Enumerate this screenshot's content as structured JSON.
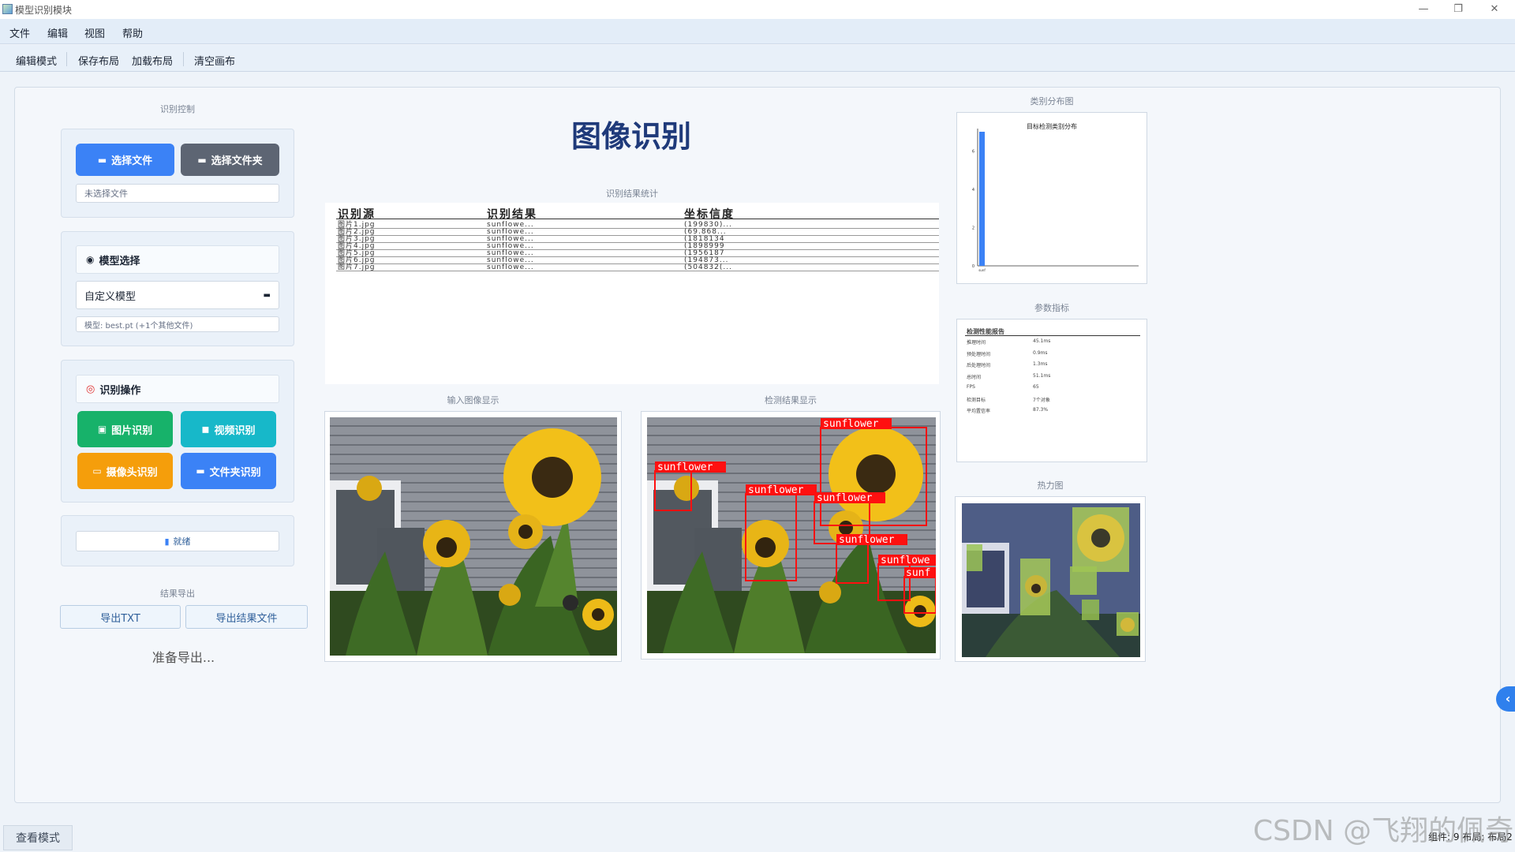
{
  "window": {
    "title": "模型识别模块",
    "minimize": "—",
    "restore": "❐",
    "close": "✕"
  },
  "menu": [
    "文件",
    "编辑",
    "视图",
    "帮助"
  ],
  "toolbar": [
    "编辑模式",
    "保存布局",
    "加载布局",
    "清空画布"
  ],
  "left": {
    "control_caption": "识别控制",
    "select_file": "选择文件",
    "select_folder": "选择文件夹",
    "file_status": "未选择文件",
    "model_header": "模型选择",
    "model_value": "自定义模型",
    "model_info": "模型: best.pt (+1个其他文件)",
    "ops_header": "识别操作",
    "op_image": "图片识别",
    "op_video": "视频识别",
    "op_camera": "摄像头识别",
    "op_folder": "文件夹识别",
    "ready": "就绪",
    "export_caption": "结果导出",
    "export_txt": "导出TXT",
    "export_file": "导出结果文件",
    "export_status": "准备导出..."
  },
  "center": {
    "title": "图像识别",
    "stats_caption": "识别结果统计",
    "table_headers": [
      "识别源",
      "识别结果",
      "坐标信度"
    ],
    "table_rows": [
      [
        "图片1.jpg",
        "sunflowe...",
        "(199830)..."
      ],
      [
        "图片2.jpg",
        "sunflowe...",
        "(69.868..."
      ],
      [
        "图片3.jpg",
        "sunflowe...",
        "(1818134"
      ],
      [
        "图片4.jpg",
        "sunflowe...",
        "(1898999"
      ],
      [
        "图片5.jpg",
        "sunflowe...",
        "(1956187"
      ],
      [
        "图片6.jpg",
        "sunflowe...",
        "(194873..."
      ],
      [
        "图片7.jpg",
        "sunflowe...",
        "(504832(..."
      ]
    ],
    "input_caption": "输入图像显示",
    "result_caption": "检测结果显示",
    "detections": [
      {
        "label": "sunflower"
      },
      {
        "label": "sunflower"
      },
      {
        "label": "sunflower"
      },
      {
        "label": "sunflower"
      },
      {
        "label": "sunflower"
      },
      {
        "label": "sunflowe"
      },
      {
        "label": "sunf"
      }
    ]
  },
  "right": {
    "dist_caption": "类别分布图",
    "param_caption": "参数指标",
    "heat_caption": "热力图"
  },
  "chart_data": {
    "type": "bar",
    "title": "目标检测类别分布",
    "categories": [
      "sunf"
    ],
    "values": [
      7
    ],
    "ylim": [
      0,
      7
    ],
    "yticks": [
      "0",
      "2",
      "4",
      "6"
    ],
    "xlabel": "",
    "ylabel": ""
  },
  "report": {
    "title": "检测性能报告",
    "rows": [
      [
        "推理时间",
        "45.1ms"
      ],
      [
        "预处理时间",
        "0.9ms"
      ],
      [
        "后处理时间",
        "1.3ms"
      ],
      [
        "总时间",
        "51.1ms"
      ],
      [
        "FPS",
        "65"
      ],
      [
        "检测目标",
        "7个对象"
      ],
      [
        "平均置信率",
        "87.3%"
      ]
    ]
  },
  "status": {
    "mode": "查看模式",
    "layout": "组件: 9 布局: 布局2"
  },
  "watermark": "CSDN @飞翔的佩奇"
}
